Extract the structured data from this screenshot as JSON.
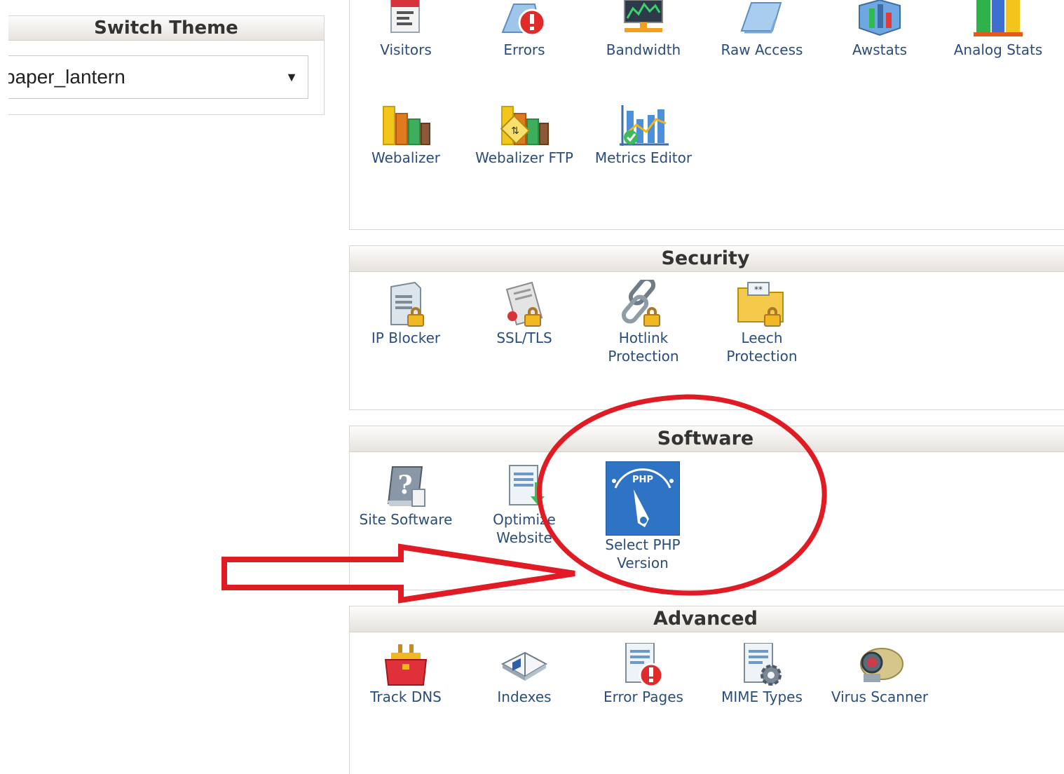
{
  "theme": {
    "title": "Switch Theme",
    "selected": "paper_lantern",
    "arrow": "▼"
  },
  "stats_panel": {
    "items": [
      {
        "label": "Visitors",
        "icon": "visitors-icon"
      },
      {
        "label": "Errors",
        "icon": "errors-icon"
      },
      {
        "label": "Bandwidth",
        "icon": "bandwidth-icon"
      },
      {
        "label": "Raw Access",
        "icon": "raw-access-icon"
      },
      {
        "label": "Awstats",
        "icon": "awstats-icon"
      },
      {
        "label": "Analog Stats",
        "icon": "analog-stats-icon"
      },
      {
        "label": "Webalizer",
        "icon": "webalizer-icon"
      },
      {
        "label": "Webalizer FTP",
        "icon": "webalizer-ftp-icon"
      },
      {
        "label": "Metrics Editor",
        "icon": "metrics-editor-icon"
      }
    ]
  },
  "security": {
    "title": "Security",
    "items": [
      {
        "label": "IP Blocker",
        "icon": "ip-blocker-icon"
      },
      {
        "label": "SSL/TLS",
        "icon": "ssl-tls-icon"
      },
      {
        "label": "Hotlink",
        "label2": "Protection",
        "icon": "hotlink-protection-icon"
      },
      {
        "label": "Leech",
        "label2": "Protection",
        "icon": "leech-protection-icon"
      }
    ]
  },
  "software": {
    "title": "Software",
    "items": [
      {
        "label": "Site Software",
        "icon": "site-software-icon"
      },
      {
        "label": "Optimize",
        "label2": "Website",
        "icon": "optimize-website-icon"
      },
      {
        "label": "Select PHP",
        "label2": "Version",
        "icon": "select-php-version-icon",
        "icon_text": "PHP"
      }
    ]
  },
  "advanced": {
    "title": "Advanced",
    "items": [
      {
        "label": "Track DNS",
        "icon": "track-dns-icon"
      },
      {
        "label": "Indexes",
        "icon": "indexes-icon"
      },
      {
        "label": "Error Pages",
        "icon": "error-pages-icon"
      },
      {
        "label": "MIME Types",
        "icon": "mime-types-icon"
      },
      {
        "label": "Virus Scanner",
        "icon": "virus-scanner-icon"
      }
    ]
  },
  "colors": {
    "annotation": "#e01b24",
    "label": "#2a4d7d",
    "php_tile": "#2f73c4"
  }
}
